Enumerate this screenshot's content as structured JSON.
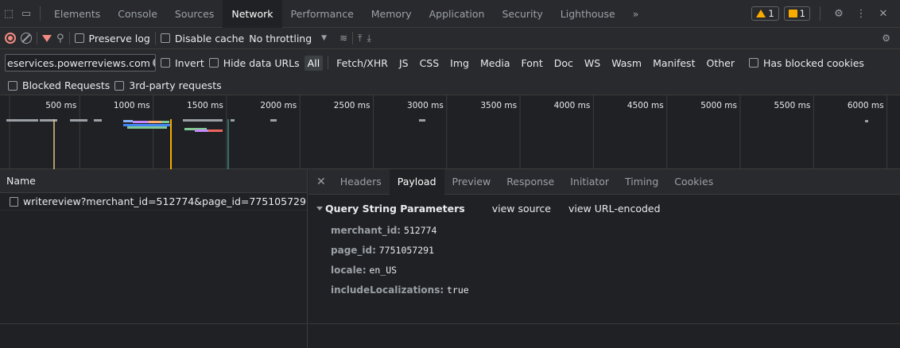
{
  "tabs": [
    "Elements",
    "Console",
    "Sources",
    "Network",
    "Performance",
    "Memory",
    "Application",
    "Security",
    "Lighthouse"
  ],
  "active_tab": "Network",
  "more_tabs_glyph": "»",
  "issues": {
    "warnings": "1",
    "messages": "1"
  },
  "toolbar": {
    "preserve_log": "Preserve log",
    "disable_cache": "Disable cache",
    "throttling": "No throttling"
  },
  "filter": {
    "value": "eservices.powerreviews.com",
    "invert": "Invert",
    "hide_data_urls": "Hide data URLs",
    "types": [
      "All",
      "Fetch/XHR",
      "JS",
      "CSS",
      "Img",
      "Media",
      "Font",
      "Doc",
      "WS",
      "Wasm",
      "Manifest",
      "Other"
    ],
    "active_type": "All",
    "has_blocked_cookies": "Has blocked cookies",
    "blocked_requests": "Blocked Requests",
    "third_party": "3rd-party requests"
  },
  "timeline": {
    "ticks": [
      "500 ms",
      "1000 ms",
      "1500 ms",
      "2000 ms",
      "2500 ms",
      "3000 ms",
      "3500 ms",
      "4000 ms",
      "4500 ms",
      "5000 ms",
      "5500 ms",
      "6000 ms"
    ],
    "colors": {
      "dom_content_loaded": "#e5c07b",
      "load": "#f9ab00",
      "finish": "#4db6ac"
    }
  },
  "requests": {
    "header": "Name",
    "rows": [
      "writereview?merchant_id=512774&page_id=775105729..."
    ]
  },
  "details": {
    "tabs": [
      "Headers",
      "Payload",
      "Preview",
      "Response",
      "Initiator",
      "Timing",
      "Cookies"
    ],
    "active_tab": "Payload",
    "section_title": "Query String Parameters",
    "view_source": "view source",
    "view_url_encoded": "view URL-encoded",
    "params": [
      {
        "key": "merchant_id:",
        "value": "512774"
      },
      {
        "key": "page_id:",
        "value": "7751057291"
      },
      {
        "key": "locale:",
        "value": "en_US"
      },
      {
        "key": "includeLocalizations:",
        "value": "true"
      }
    ]
  }
}
